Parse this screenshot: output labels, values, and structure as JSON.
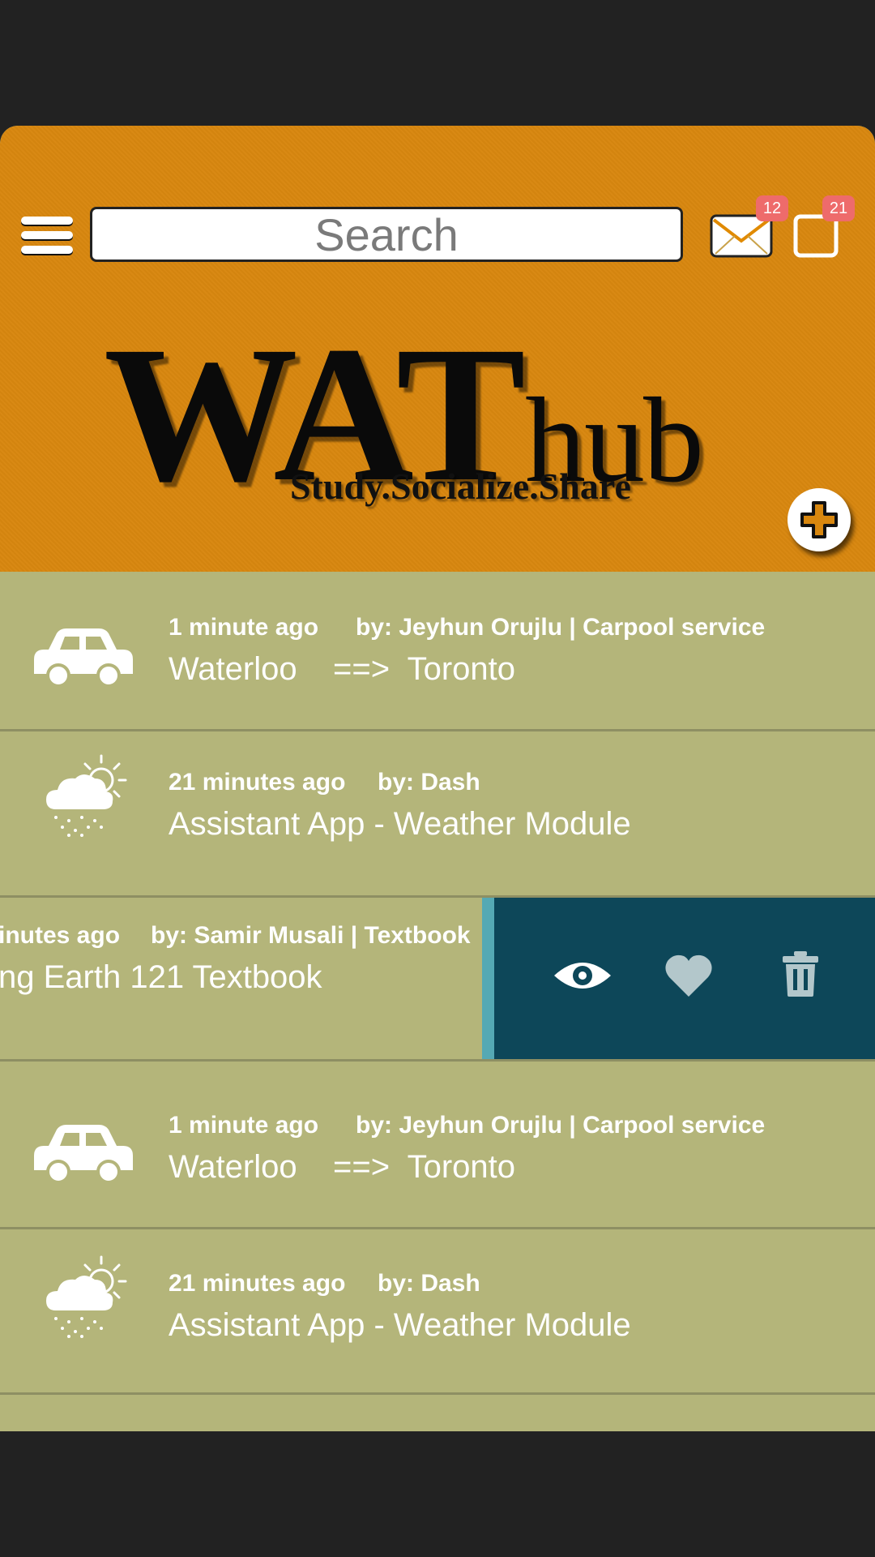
{
  "header": {
    "search_placeholder": "Search",
    "messages_badge": "12",
    "notifications_badge": "21",
    "logo_main": "WAT",
    "logo_sub": "hub",
    "tagline": "Study.Socialize.Share"
  },
  "feed": [
    {
      "icon": "car-icon",
      "time": "1 minute ago",
      "author": "by: Jeyhun Orujlu | Carpool service",
      "title": "Waterloo    ==>  Toronto"
    },
    {
      "icon": "weather-icon",
      "time": "21 minutes ago",
      "author": "by: Dash",
      "title": "Assistant App - Weather Module"
    },
    {
      "icon": "book-icon",
      "time": "inutes ago",
      "author": "by: Samir Musali | Textbook",
      "title": "ng Earth 121 Textbook"
    },
    {
      "icon": "car-icon",
      "time": "1 minute ago",
      "author": "by: Jeyhun Orujlu | Carpool service",
      "title": "Waterloo    ==>  Toronto"
    },
    {
      "icon": "weather-icon",
      "time": "21 minutes ago",
      "author": "by: Dash",
      "title": "Assistant App - Weather Module"
    }
  ],
  "swipe_actions": [
    "view-icon",
    "like-icon",
    "trash-icon"
  ],
  "colors": {
    "header": "#d8870f",
    "feed": "#b4b57a",
    "swipe_panel": "#0d4759",
    "swipe_accent": "#55a9b4",
    "badge": "#ee6b6b"
  }
}
